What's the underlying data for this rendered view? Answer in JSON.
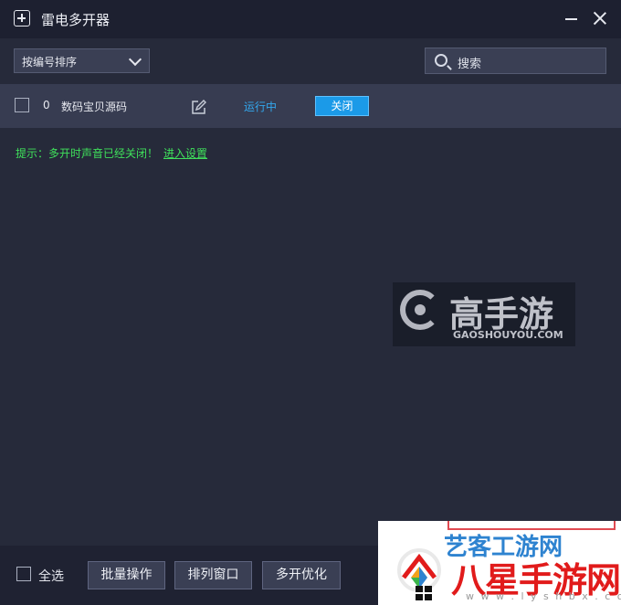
{
  "window": {
    "title": "雷电多开器"
  },
  "toolbar": {
    "sort_label": "按编号排序",
    "search_placeholder": "搜索"
  },
  "instances": [
    {
      "index": "0",
      "name": "数码宝贝源码",
      "status": "运行中",
      "action": "关闭"
    }
  ],
  "tip": {
    "text": "提示：多开时声音已经关闭！",
    "link": "进入设置"
  },
  "watermark": {
    "title": "高手游",
    "url": "GAOSHOUYOU.COM"
  },
  "footer": {
    "select_all": "全选",
    "batch_ops": "批量操作",
    "arrange_windows": "排列窗口",
    "optimize": "多开优化"
  },
  "overlay_logo": {
    "partial_text": "艺客工游网",
    "name": "八星手游网",
    "url": "w w w . l y s h b x . c o m"
  },
  "colors": {
    "accent": "#1b9ae8",
    "status": "#33a8ef",
    "tip": "#3fe05b",
    "logo_red": "#e11b1b"
  }
}
